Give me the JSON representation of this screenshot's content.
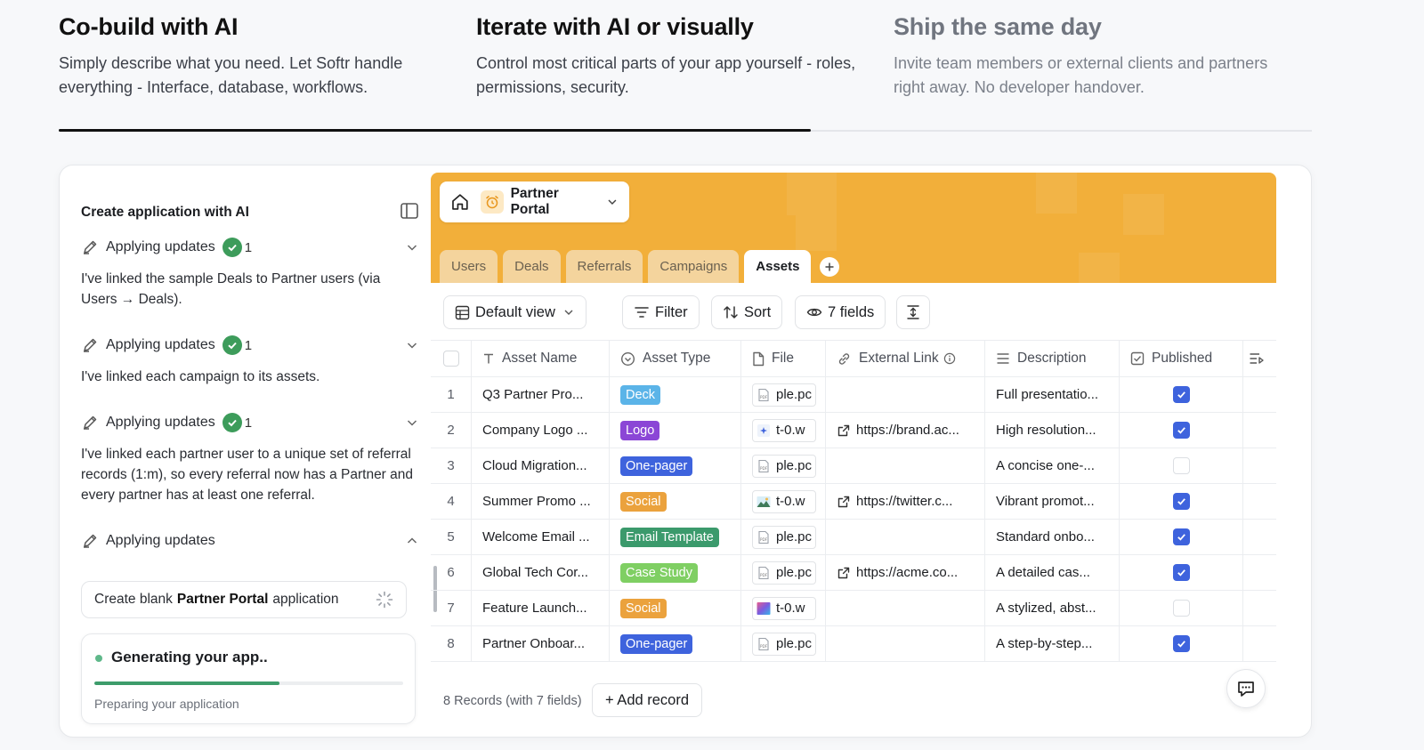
{
  "features": [
    {
      "title": "Co-build with AI",
      "desc": "Simply describe what you need. Let Softr handle everything - Interface, database, workflows."
    },
    {
      "title": "Iterate with AI or visually",
      "desc": "Control most critical parts of your app yourself - roles, permissions, security."
    },
    {
      "title": "Ship the same day",
      "desc": "Invite team members or external clients and partners right away. No developer handover."
    }
  ],
  "progress_fraction": 0.6,
  "left_panel": {
    "title": "Create application with AI",
    "updates": [
      {
        "label": "Applying updates",
        "count": "1",
        "body": "I've linked the sample Deals to Partner users (via Users → Deals)."
      },
      {
        "label": "Applying updates",
        "count": "1",
        "body": "I've linked each campaign to its assets."
      },
      {
        "label": "Applying updates",
        "count": "1",
        "body": "I've linked each partner user to a unique set of referral records (1:m), so every referral now has a Partner and every partner has at least one referral."
      },
      {
        "label": "Applying updates"
      }
    ],
    "task": {
      "prefix": "Create blank",
      "app_name": "Partner Portal",
      "suffix": "application"
    },
    "generating": {
      "title": "Generating your app..",
      "subtitle": "Preparing your application",
      "progress": 0.6
    }
  },
  "app": {
    "name": "Partner Portal",
    "banner_color": "#f2af3a",
    "tabs": [
      "Users",
      "Deals",
      "Referrals",
      "Campaigns",
      "Assets"
    ],
    "active_tab": "Assets",
    "toolbar": {
      "view": "Default view",
      "filter": "Filter",
      "sort": "Sort",
      "fields": "7 fields"
    },
    "columns": [
      "Asset Name",
      "Asset Type",
      "File",
      "External Link",
      "Description",
      "Published"
    ],
    "rows": [
      {
        "n": "1",
        "name": "Q3 Partner Pro...",
        "type": "Deck",
        "type_color": "#5bb4e8",
        "file": "ple.pc",
        "file_icon": "pdf-icon",
        "link": "",
        "desc": "Full presentatio...",
        "published": true
      },
      {
        "n": "2",
        "name": "Company Logo ...",
        "type": "Logo",
        "type_color": "#8b46d6",
        "file": "t-0.w",
        "file_icon": "star-image-icon",
        "link": "https://brand.ac...",
        "desc": "High resolution...",
        "published": true
      },
      {
        "n": "3",
        "name": "Cloud Migration...",
        "type": "One-pager",
        "type_color": "#3e63dd",
        "file": "ple.pc",
        "file_icon": "pdf-icon",
        "link": "",
        "desc": "A concise one-...",
        "published": false
      },
      {
        "n": "4",
        "name": "Summer Promo ...",
        "type": "Social",
        "type_color": "#eba23d",
        "file": "t-0.w",
        "file_icon": "photo-thumb-icon",
        "link": "https://twitter.c...",
        "desc": "Vibrant promot...",
        "published": true
      },
      {
        "n": "5",
        "name": "Welcome Email ...",
        "type": "Email Template",
        "type_color": "#3b9a6c",
        "file": "ple.pc",
        "file_icon": "pdf-icon",
        "link": "",
        "desc": "Standard onbo...",
        "published": true
      },
      {
        "n": "6",
        "name": "Global Tech Cor...",
        "type": "Case Study",
        "type_color": "#7fcf63",
        "file": "ple.pc",
        "file_icon": "pdf-icon",
        "link": "https://acme.co...",
        "desc": "A detailed cas...",
        "published": true
      },
      {
        "n": "7",
        "name": "Feature Launch...",
        "type": "Social",
        "type_color": "#eba23d",
        "file": "t-0.w",
        "file_icon": "gradient-thumb-icon",
        "link": "",
        "desc": "A stylized, abst...",
        "published": false
      },
      {
        "n": "8",
        "name": "Partner Onboar...",
        "type": "One-pager",
        "type_color": "#3e63dd",
        "file": "ple.pc",
        "file_icon": "pdf-icon",
        "link": "",
        "desc": "A step-by-step...",
        "published": true
      }
    ],
    "footer": {
      "records": "8 Records (with 7 fields)",
      "add": "+ Add record"
    }
  }
}
